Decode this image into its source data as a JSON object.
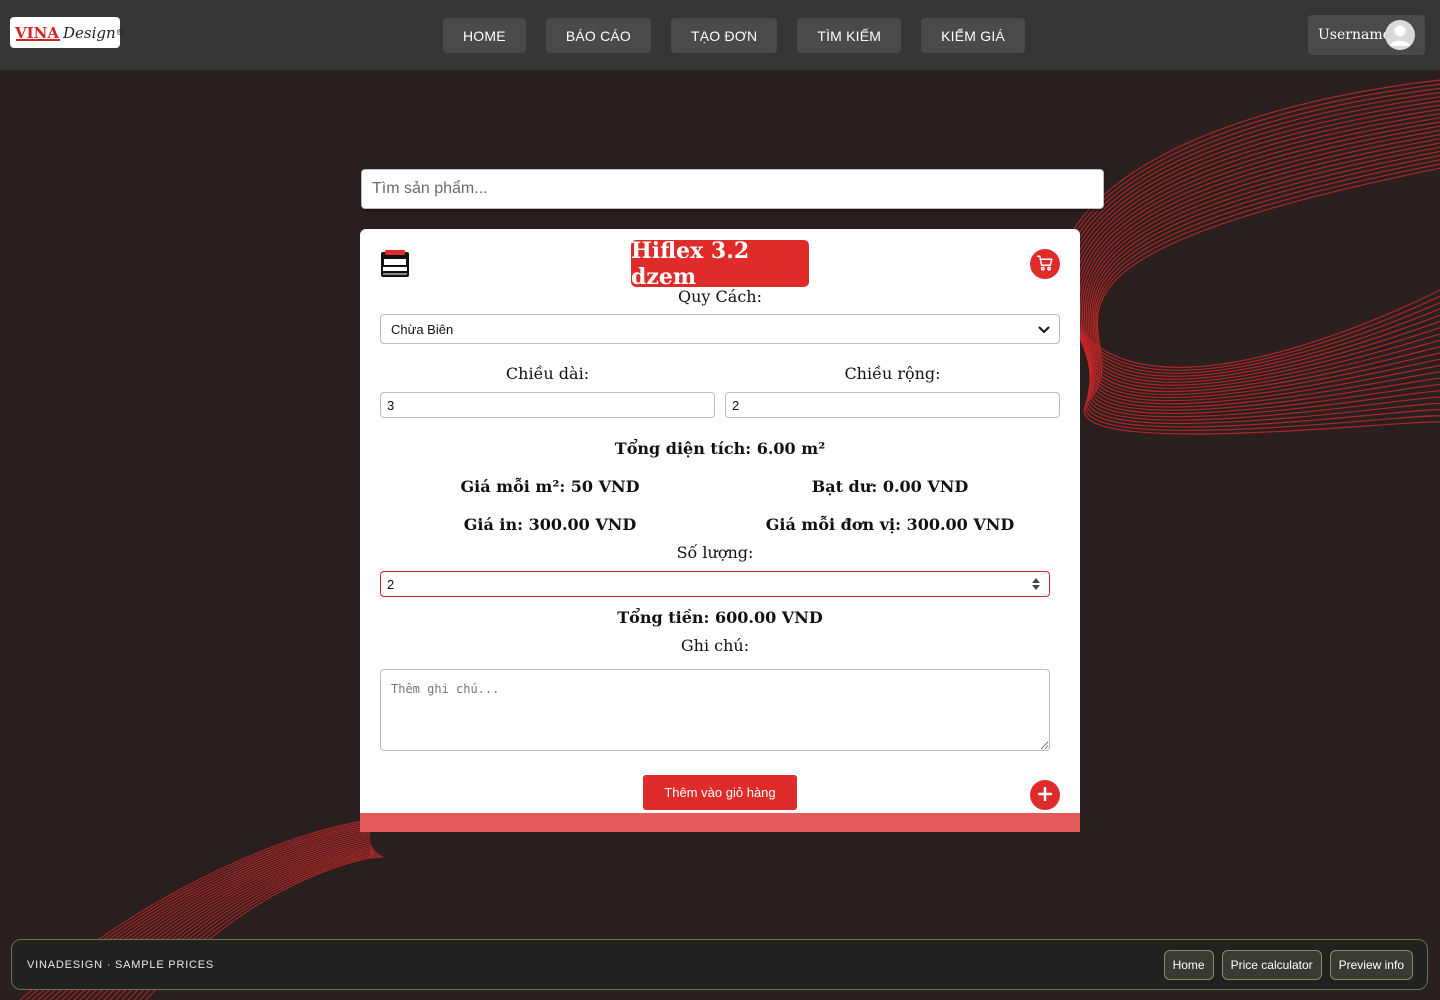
{
  "header": {
    "logo": {
      "brand_red": "VINA",
      "brand_dark": "Design",
      "reg_mark": "®"
    },
    "nav": [
      {
        "label": "HOME"
      },
      {
        "label": "BÁO CÁO"
      },
      {
        "label": "TẠO ĐƠN"
      },
      {
        "label": "TÌM KIẾM"
      },
      {
        "label": "KIỂM GIÁ"
      }
    ],
    "user": {
      "name": "Username"
    }
  },
  "search": {
    "placeholder": "Tìm sản phẩm..."
  },
  "product": {
    "title": "Hiflex 3.2 dzem",
    "spec_label": "Quy Cách:",
    "spec_value": "Chừa Biên",
    "length_label": "Chiều dài:",
    "length_value": "3",
    "width_label": "Chiều rộng:",
    "width_value": "2",
    "total_area": "Tổng diện tích: 6.00 m²",
    "price_per_m2": "Giá mỗi m²: 50 VND",
    "excess_canvas": "Bạt dư: 0.00 VND",
    "print_price": "Giá in: 300.00 VND",
    "unit_price": "Giá mỗi đơn vị: 300.00 VND",
    "quantity_label": "Số lượng:",
    "quantity_value": "2",
    "total_price": "Tổng tiền: 600.00 VND",
    "note_label": "Ghi chú:",
    "note_placeholder": "Thêm ghi chú...",
    "add_to_cart_label": "Thêm vào giỏ hàng",
    "icons": {
      "product": "product-stack-icon",
      "cart": "cart-icon",
      "add": "plus-icon"
    }
  },
  "footer": {
    "brand": "VINADESIGN · SAMPLE PRICES",
    "links": [
      {
        "label": "Home"
      },
      {
        "label": "Price calculator"
      },
      {
        "label": "Preview info"
      }
    ]
  },
  "colors": {
    "accent": "#e02b2b",
    "background": "#2a1f1f",
    "header": "#363636",
    "wave": "#c62828"
  }
}
